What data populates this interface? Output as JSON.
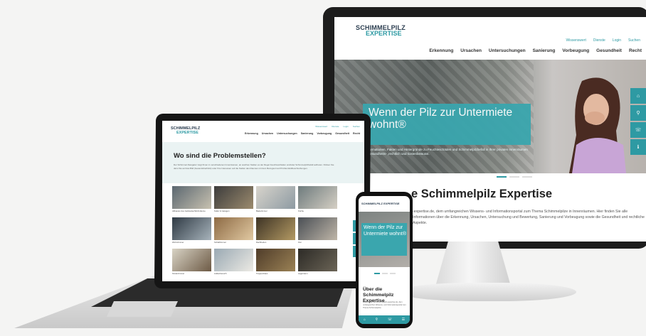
{
  "colors": {
    "accent": "#2e9aa3",
    "banner": "#3aa6ae",
    "dark": "#1d1d1d"
  },
  "monitor": {
    "logo_line1": "SCHIMMELPILZ",
    "logo_line2": "EXPERTISE",
    "topbar": [
      "Wissenswert",
      "Dienste",
      "Login",
      "Suchen"
    ],
    "nav": [
      "Erkennung",
      "Ursachen",
      "Untersuchungen",
      "Sanierung",
      "Vorbeugung",
      "Gesundheit",
      "Recht"
    ],
    "hero_title": "Wenn der Pilz zur Untermiete wohnt®",
    "hero_sub": "Informationen, Fakten und Hintergründe zu Feuchteschäden und Schimmelpilzbefall in Ihrer privaten Innenräumen – gesundheits- ,rechtlich und kostenbewusst.",
    "side_icons": [
      "home-icon",
      "search-icon",
      "phone-icon",
      "info-icon"
    ],
    "heading": "e Schimmelpilz Expertise",
    "paragraph": "-expertise.de, dem umfangreichen Wissens- und Informationsportal zum Thema Schimmelpilze in Innenräumen. Hier finden Sie alle Informationen über die Erkennung, Ursachen, Untersuchung und Bewertung, Sanierung und Vorbeugung sowie die Gesundheit und rechtliche Aspekte."
  },
  "laptop": {
    "logo_line1": "SCHIMMELPILZ",
    "logo_line2": "EXPERTISE",
    "topbar": [
      "Wissenswert",
      "Dienste",
      "Login",
      "Suchen"
    ],
    "nav": [
      "Erkennung",
      "Ursachen",
      "Untersuchungen",
      "Sanierung",
      "Vorbeugung",
      "Gesundheit",
      "Recht"
    ],
    "heading": "Wo sind die Problemstellen?",
    "paragraph": "Der Schimmel-Navigator zeigt Ihnen in verschiedenen Innenräumen, an welchen Stellen es der Regel Feuchteschäden und/oder Schimmelpilzbefall auftreten. Klicken Sie dazu Sie auf das Bild (Gesamtüberblick) oder Ihre Interessen auf die Stellen des Raumes mit dem Bezugsort auf Problemfeldbeschreibungen.",
    "tiles": [
      "Altbauten des Gebäudes/Wohnräume",
      "Keller & Garagen",
      "Badezimmer",
      "Küche",
      "Wohnzimmer",
      "Schlafzimmer",
      "Dachboden",
      "Flur",
      "Kinderzimmer",
      "Außenbereich",
      "Treppenhaus",
      "Lagerraum"
    ]
  },
  "phone": {
    "logo": "SCHIMMELPILZ EXPERTISE",
    "hero_title": "Wenn der Pilz zur Untermiete wohnt®",
    "heading": "Über die Schimmelpilz Expertise",
    "paragraph": "Willkommen auf schimmelpilz-expertise.de, dem umfangreichen Wissens- und Informationsportal zum Thema Schimmelpilze."
  }
}
